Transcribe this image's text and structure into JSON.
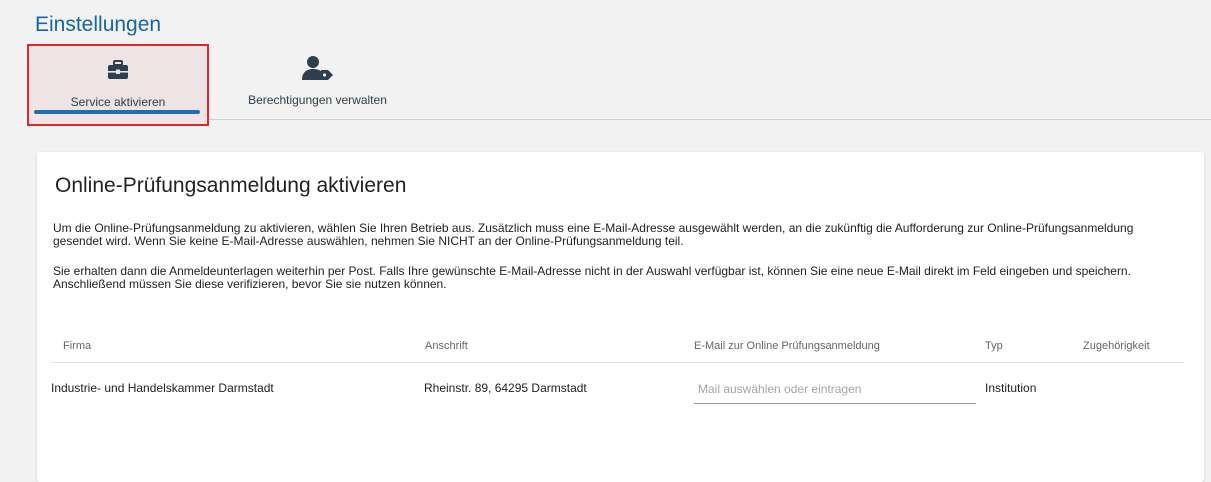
{
  "page": {
    "title": "Einstellungen"
  },
  "tabs": [
    {
      "label": "Service aktivieren",
      "icon": "toolbox-icon",
      "active": true
    },
    {
      "label": "Berechtigungen verwalten",
      "icon": "user-tag-icon",
      "active": false
    }
  ],
  "card": {
    "title": "Online-Prüfungsanmeldung aktivieren",
    "paragraph1": "Um die Online-Prüfungsanmeldung zu aktivieren, wählen Sie Ihren Betrieb aus. Zusätzlich muss eine E-Mail-Adresse ausgewählt werden, an die zukünftig die Aufforderung zur Online-Prüfungsanmeldung gesendet wird. Wenn Sie keine E-Mail-Adresse auswählen, nehmen Sie NICHT an der Online-Prüfungsanmeldung teil.",
    "paragraph2": "Sie erhalten dann die Anmeldeunterlagen weiterhin per Post. Falls Ihre gewünschte E-Mail-Adresse nicht in der Auswahl verfügbar ist, können Sie eine neue E-Mail direkt im Feld eingeben und speichern. Anschließend müssen Sie diese verifizieren, bevor Sie sie nutzen können."
  },
  "table": {
    "headers": {
      "firma": "Firma",
      "anschrift": "Anschrift",
      "email": "E-Mail zur Online Prüfungsanmeldung",
      "typ": "Typ",
      "zugehoerigkeit": "Zugehörigkeit"
    },
    "rows": [
      {
        "firma": "Industrie- und Handelskammer Darmstadt",
        "anschrift": "Rheinstr. 89, 64295 Darmstadt",
        "email_value": "",
        "email_placeholder": "Mail auswählen oder eintragen",
        "typ": "Institution",
        "zugehoerigkeit": ""
      }
    ]
  },
  "colors": {
    "accent": "#1565a6",
    "highlight_border": "#e0282c",
    "tab_underline": "#1f6fb0"
  }
}
